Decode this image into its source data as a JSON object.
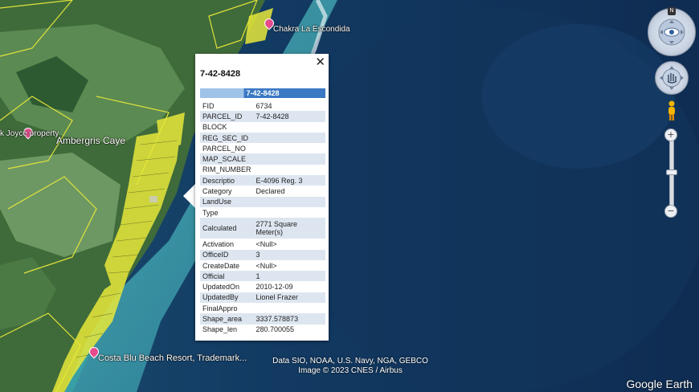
{
  "map": {
    "place_labels": {
      "chakra": "Chakra La Escondida",
      "joyce": "k Joyce property",
      "ambergris": "Ambergris Caye",
      "costa_blu": "Costa Blu Beach Resort, Trademark..."
    },
    "attribution_line1": "Data SIO, NOAA, U.S. Navy, NGA, GEBCO",
    "attribution_line2": "Image © 2023 CNES / Airbus",
    "logo": "Google Earth",
    "north_label": "N"
  },
  "popup": {
    "title": "7-42-8428",
    "header": "7-42-8428",
    "close": "✕",
    "rows": [
      {
        "key": "FID",
        "value": "6734"
      },
      {
        "key": "PARCEL_ID",
        "value": "7-42-8428"
      },
      {
        "key": "BLOCK",
        "value": ""
      },
      {
        "key": "REG_SEC_ID",
        "value": ""
      },
      {
        "key": "PARCEL_NO",
        "value": ""
      },
      {
        "key": "MAP_SCALE",
        "value": ""
      },
      {
        "key": "RIM_NUMBER",
        "value": ""
      },
      {
        "key": "Descriptio",
        "value": "E-4096 Reg. 3"
      },
      {
        "key": "Category",
        "value": "Declared"
      },
      {
        "key": "LandUse",
        "value": ""
      },
      {
        "key": "Type",
        "value": ""
      },
      {
        "key": "Calculated",
        "value": "2771 Square Meter(s)"
      },
      {
        "key": "Activation",
        "value": "<Null>"
      },
      {
        "key": "OfficeID",
        "value": "3"
      },
      {
        "key": "CreateDate",
        "value": "<Null>"
      },
      {
        "key": "Official",
        "value": "1"
      },
      {
        "key": "UpdatedOn",
        "value": "2010-12-09"
      },
      {
        "key": "UpdatedBy",
        "value": "Lionel Frazer"
      },
      {
        "key": "FinalAppro",
        "value": ""
      },
      {
        "key": "Shape_area",
        "value": "3337.578873"
      },
      {
        "key": "Shape_len",
        "value": "280.700055"
      }
    ]
  },
  "controls": {
    "zoom_in": "+",
    "zoom_out": "−",
    "zoom_level_fraction": 0.5
  },
  "colors": {
    "parcel_outline": "#e8e83a",
    "pin": "#e64b8b",
    "header_blue": "#3b78c4"
  }
}
